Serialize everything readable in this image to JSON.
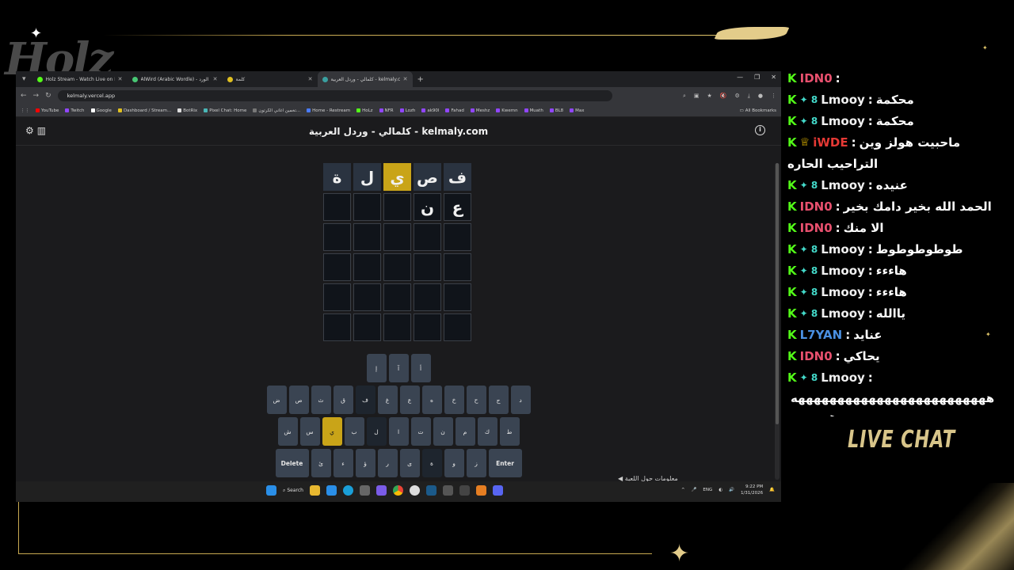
{
  "overlay": {
    "logo_text": "Holz",
    "live_chat_label": "LIVE CHAT"
  },
  "browser": {
    "tabs": [
      {
        "title": "Holz Stream - Watch Live on Ki",
        "color": "#53fc18"
      },
      {
        "title": "AlWird (Arabic Wordle) - الورد",
        "color": "#48c774"
      },
      {
        "title": "كلمة",
        "color": "#e0c020"
      },
      {
        "title": "كلمالي - وردل العربية - kelmaly.com",
        "color": "#3aa0a0",
        "active": true
      }
    ],
    "url": "kelmaly.vercel.app",
    "bookmarks": [
      {
        "label": "YouTube",
        "color": "#ff0000"
      },
      {
        "label": "Twitch",
        "color": "#9146ff"
      },
      {
        "label": "Google",
        "color": "#ffffff"
      },
      {
        "label": "Dashboard / Stream...",
        "color": "#e0c020"
      },
      {
        "label": "BotRix",
        "color": "#dddddd"
      },
      {
        "label": "Pixel Chat: Home",
        "color": "#4ab7b7"
      },
      {
        "label": "تخمين اغاني الكرتون...",
        "color": "#777777"
      },
      {
        "label": "Home - Restream",
        "color": "#4a7bff"
      },
      {
        "label": "HoLz",
        "color": "#53fc18"
      },
      {
        "label": "NFR",
        "color": "#9146ff"
      },
      {
        "label": "Lozh",
        "color": "#9146ff"
      },
      {
        "label": "ak90l",
        "color": "#9146ff"
      },
      {
        "label": "Fahad",
        "color": "#9146ff"
      },
      {
        "label": "Meshz",
        "color": "#9146ff"
      },
      {
        "label": "Kwemn",
        "color": "#9146ff"
      },
      {
        "label": "Muath",
        "color": "#9146ff"
      },
      {
        "label": "BL8",
        "color": "#9146ff"
      },
      {
        "label": "Max",
        "color": "#9146ff"
      }
    ],
    "all_bookmarks": "All Bookmarks"
  },
  "game": {
    "title": "كلمالي - وردل العربية - kelmaly.com",
    "rows": [
      [
        {
          "letter": "ف",
          "state": "filled"
        },
        {
          "letter": "ص",
          "state": "filled"
        },
        {
          "letter": "ي",
          "state": "present"
        },
        {
          "letter": "ل",
          "state": "filled"
        },
        {
          "letter": "ة",
          "state": "filled"
        }
      ],
      [
        {
          "letter": "ع",
          "state": "empty"
        },
        {
          "letter": "ن",
          "state": "empty"
        },
        {
          "letter": "",
          "state": "empty"
        },
        {
          "letter": "",
          "state": "empty"
        },
        {
          "letter": "",
          "state": "empty"
        }
      ],
      [
        {
          "letter": "",
          "state": "empty"
        },
        {
          "letter": "",
          "state": "empty"
        },
        {
          "letter": "",
          "state": "empty"
        },
        {
          "letter": "",
          "state": "empty"
        },
        {
          "letter": "",
          "state": "empty"
        }
      ],
      [
        {
          "letter": "",
          "state": "empty"
        },
        {
          "letter": "",
          "state": "empty"
        },
        {
          "letter": "",
          "state": "empty"
        },
        {
          "letter": "",
          "state": "empty"
        },
        {
          "letter": "",
          "state": "empty"
        }
      ],
      [
        {
          "letter": "",
          "state": "empty"
        },
        {
          "letter": "",
          "state": "empty"
        },
        {
          "letter": "",
          "state": "empty"
        },
        {
          "letter": "",
          "state": "empty"
        },
        {
          "letter": "",
          "state": "empty"
        }
      ],
      [
        {
          "letter": "",
          "state": "empty"
        },
        {
          "letter": "",
          "state": "empty"
        },
        {
          "letter": "",
          "state": "empty"
        },
        {
          "letter": "",
          "state": "empty"
        },
        {
          "letter": "",
          "state": "empty"
        }
      ]
    ],
    "keyboard": [
      [
        {
          "k": "أ"
        },
        {
          "k": "آ"
        },
        {
          "k": "إ"
        }
      ],
      [
        {
          "k": "د"
        },
        {
          "k": "ج"
        },
        {
          "k": "ح"
        },
        {
          "k": "خ"
        },
        {
          "k": "ه"
        },
        {
          "k": "ع"
        },
        {
          "k": "غ"
        },
        {
          "k": "ف",
          "s": "dark"
        },
        {
          "k": "ق"
        },
        {
          "k": "ث"
        },
        {
          "k": "ص"
        },
        {
          "k": "ض"
        }
      ],
      [
        {
          "k": "ط"
        },
        {
          "k": "ك"
        },
        {
          "k": "م"
        },
        {
          "k": "ن"
        },
        {
          "k": "ت"
        },
        {
          "k": "ا"
        },
        {
          "k": "ل",
          "s": "dark"
        },
        {
          "k": "ب"
        },
        {
          "k": "ي",
          "s": "yellow"
        },
        {
          "k": "س"
        },
        {
          "k": "ش"
        }
      ],
      [
        {
          "k": "Enter",
          "s": "wide"
        },
        {
          "k": "ز"
        },
        {
          "k": "و"
        },
        {
          "k": "ة",
          "s": "dark"
        },
        {
          "k": "ى"
        },
        {
          "k": "ر"
        },
        {
          "k": "ؤ"
        },
        {
          "k": "ء"
        },
        {
          "k": "ئ"
        },
        {
          "k": "Delete",
          "s": "wide"
        }
      ]
    ],
    "below_text": "◀ معلومات حول اللعبة"
  },
  "taskbar": {
    "search": "Search",
    "lang": "ENG",
    "time": "9:22 PM",
    "date": "1/31/2026"
  },
  "chat": {
    "messages": [
      {
        "user": "IDN0",
        "color": "#e8506e",
        "badges": "",
        "text": ""
      },
      {
        "user": "Lmooy",
        "color": "#f0f0f0",
        "badges": "✦ 8",
        "text": "محكمة"
      },
      {
        "user": "Lmooy",
        "color": "#f0f0f0",
        "badges": "✦ 8",
        "text": "محكمة"
      },
      {
        "user": "iWDE",
        "color": "#e53935",
        "badges": "♕",
        "text": "ماحبيت هولز وين"
      },
      {
        "user": "",
        "color": "#ffffff",
        "badges": "",
        "text": "التراحيب الحاره"
      },
      {
        "user": "Lmooy",
        "color": "#f0f0f0",
        "badges": "✦ 8",
        "text": "عنيده"
      },
      {
        "user": "IDN0",
        "color": "#e8506e",
        "badges": "",
        "text": "الحمد الله بخير دامك بخير"
      },
      {
        "user": "IDN0",
        "color": "#e8506e",
        "badges": "",
        "text": "الا منك"
      },
      {
        "user": "Lmooy",
        "color": "#f0f0f0",
        "badges": "✦ 8",
        "text": "طوطوطوطوط"
      },
      {
        "user": "Lmooy",
        "color": "#f0f0f0",
        "badges": "✦ 8",
        "text": "هاءءء"
      },
      {
        "user": "Lmooy",
        "color": "#f0f0f0",
        "badges": "✦ 8",
        "text": "هاءءء"
      },
      {
        "user": "Lmooy",
        "color": "#f0f0f0",
        "badges": "✦ 8",
        "text": "ياالله"
      },
      {
        "user": "L7YAN",
        "color": "#4a90e2",
        "badges": "",
        "text": "عنايد"
      },
      {
        "user": "IDN0",
        "color": "#e8506e",
        "badges": "",
        "text": "يحاكي"
      },
      {
        "user": "Lmooy",
        "color": "#f0f0f0",
        "badges": "✦ 8",
        "text": ""
      }
    ],
    "continuation": [
      "هههههههههههههههههههههههههه",
      "هههههه"
    ]
  }
}
